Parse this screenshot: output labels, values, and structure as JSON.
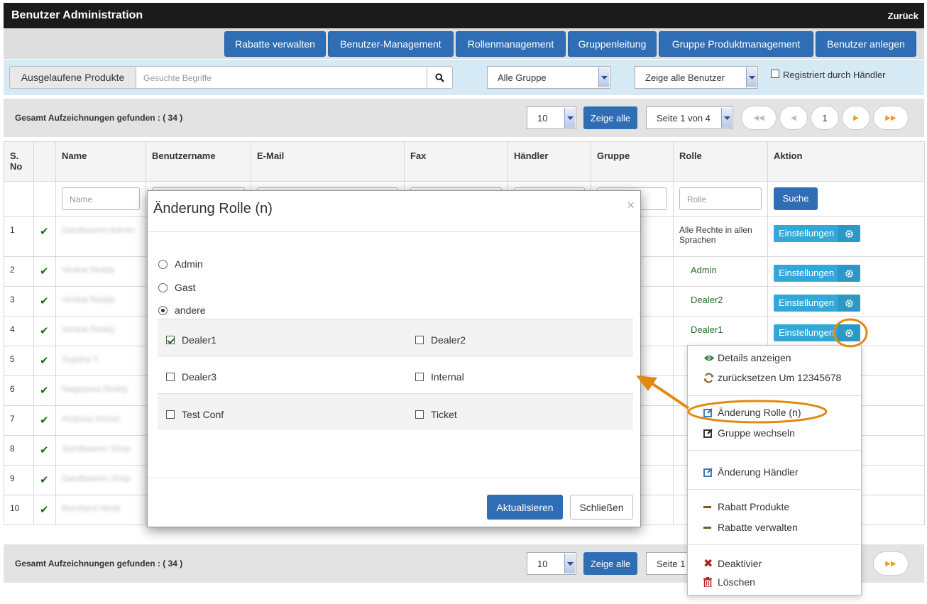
{
  "app": {
    "title": "Benutzer Administration",
    "back": "Zurück"
  },
  "nav": [
    "Rabatte verwalten",
    "Benutzer-Management",
    "Rollenmanagement",
    "Gruppenleitung",
    "Gruppe Produktmanagement",
    "Benutzer anlegen"
  ],
  "filter": {
    "expired_button": "Ausgelaufene Produkte",
    "search_placeholder": "Gesuchte Begriffe",
    "group_select": "Alle Gruppe",
    "user_select": "Zeige alle Benutzer",
    "dealer_checkbox": "Registriert durch Händler"
  },
  "pager": {
    "total": "Gesamt Aufzeichnungen gefunden : ( 34 )",
    "per_page": "10",
    "show_all": "Zeige alle",
    "page_select": "Seite 1 von 4",
    "page_select_partial": "Seite 1",
    "first": "◀◀",
    "prev": "◀",
    "current": "1",
    "next": "▶",
    "last": "▶▶"
  },
  "table": {
    "headers": {
      "sno": "S. No",
      "name": "Name",
      "username": "Benutzername",
      "email": "E-Mail",
      "fax": "Fax",
      "dealer": "Händler",
      "group": "Gruppe",
      "role": "Rolle",
      "action": "Aktion"
    },
    "filters": {
      "name": "Name",
      "role": "Rolle",
      "search": "Suche"
    },
    "action_label": "Einstellungen",
    "rows": [
      {
        "no": "1",
        "name": "Sandbaeren Admin",
        "role": "Alle Rechte in allen Sprachen"
      },
      {
        "no": "2",
        "name": "Venkat Reddy",
        "role": "Admin"
      },
      {
        "no": "3",
        "name": "Venkat Reddy",
        "role": "Dealer2"
      },
      {
        "no": "4",
        "name": "Venkat Reddy",
        "role": "Dealer1"
      },
      {
        "no": "5",
        "name": "Sujatha Y",
        "role": ""
      },
      {
        "no": "6",
        "name": "Nagarjuna Reddy",
        "role": ""
      },
      {
        "no": "7",
        "name": "Andreas Krizan",
        "role": ""
      },
      {
        "no": "8",
        "name": "Sandbaeren Shop",
        "role": ""
      },
      {
        "no": "9",
        "name": "Sandbaeren Shop",
        "role": ""
      },
      {
        "no": "10",
        "name": "Bernhard Hinds",
        "role": ""
      }
    ]
  },
  "modal": {
    "title": "Änderung Rolle (n)",
    "close": "×",
    "radios": [
      {
        "label": "Admin",
        "checked": false
      },
      {
        "label": "Gast",
        "checked": false
      },
      {
        "label": "andere",
        "checked": true
      }
    ],
    "checkboxes": [
      {
        "label": "Dealer1",
        "checked": true
      },
      {
        "label": "Dealer2",
        "checked": false
      },
      {
        "label": "Dealer3",
        "checked": false
      },
      {
        "label": "Internal",
        "checked": false
      },
      {
        "label": "Test Conf",
        "checked": false
      },
      {
        "label": "Ticket",
        "checked": false
      }
    ],
    "update": "Aktualisieren",
    "close_button": "Schließen"
  },
  "menu": [
    {
      "label": "Details anzeigen",
      "icon": "eye-icon"
    },
    {
      "label": "zurücksetzen Um 12345678",
      "icon": "refresh-icon"
    },
    {
      "label": "Änderung Rolle (n)",
      "icon": "edit-icon"
    },
    {
      "label": "Gruppe wechseln",
      "icon": "edit-icon"
    },
    {
      "label": "Änderung Händler",
      "icon": "edit-icon"
    },
    {
      "label": "Rabatt Produkte",
      "icon": "minus-icon"
    },
    {
      "label": "Rabatte verwalten",
      "icon": "minus-icon"
    },
    {
      "label": "Deaktivier",
      "icon": "x-icon"
    },
    {
      "label": "Löschen",
      "icon": "trash-icon"
    }
  ],
  "colors": {
    "primary": "#2f6db5",
    "info": "#33a8d8",
    "highlight": "#e08a12",
    "topbar": "#1b1b1b"
  }
}
